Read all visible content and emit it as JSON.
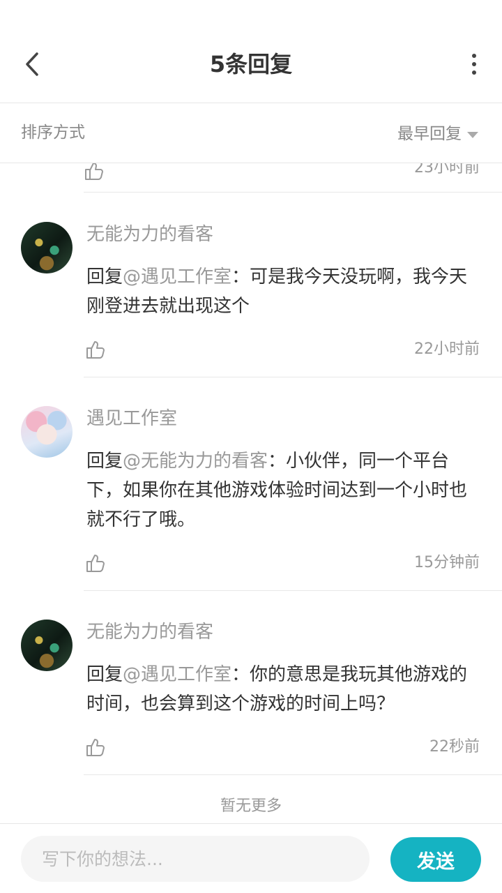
{
  "header": {
    "title": "5条回复"
  },
  "sort": {
    "label": "排序方式",
    "selected": "最早回复"
  },
  "partial_reply": {
    "time": "23小时前"
  },
  "replies": [
    {
      "author": "无能为力的看客",
      "prefix": "回复",
      "mention": "@遇见工作室",
      "sep": "：",
      "text": "可是我今天没玩啊，我今天刚登进去就出现这个",
      "time": "22小时前"
    },
    {
      "author": "遇见工作室",
      "prefix": "回复",
      "mention": "@无能为力的看客",
      "sep": "：",
      "text": "小伙伴，同一个平台下，如果你在其他游戏体验时间达到一个小时也就不行了哦。",
      "time": "15分钟前"
    },
    {
      "author": "无能为力的看客",
      "prefix": "回复",
      "mention": "@遇见工作室",
      "sep": "：",
      "text": "你的意思是我玩其他游戏的时间，也会算到这个游戏的时间上吗？",
      "time": "22秒前"
    }
  ],
  "footer": {
    "no_more": "暂无更多"
  },
  "composer": {
    "placeholder": "写下你的想法...",
    "send_label": "发送"
  },
  "colors": {
    "accent": "#15b3c2",
    "muted_text": "#999999",
    "body_text": "#333333"
  },
  "icons": {
    "back": "chevron-left-icon",
    "more": "vertical-dots-icon",
    "like": "thumbs-up-icon",
    "sort": "caret-down-icon"
  }
}
